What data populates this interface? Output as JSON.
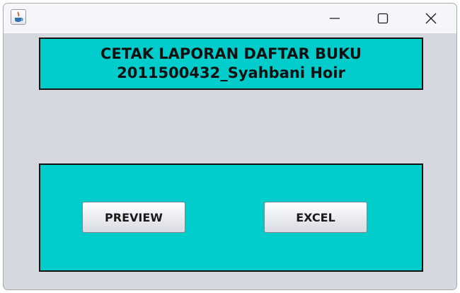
{
  "window": {
    "icon": "java-cup-icon",
    "controls": [
      "minimize-icon",
      "maximize-icon",
      "close-icon"
    ]
  },
  "header": {
    "line1": "CETAK LAPORAN DAFTAR BUKU",
    "line2": "2011500432_Syahbani Hoir",
    "background": "#00cccc"
  },
  "actions": {
    "preview_label": "PREVIEW",
    "excel_label": "EXCEL"
  }
}
